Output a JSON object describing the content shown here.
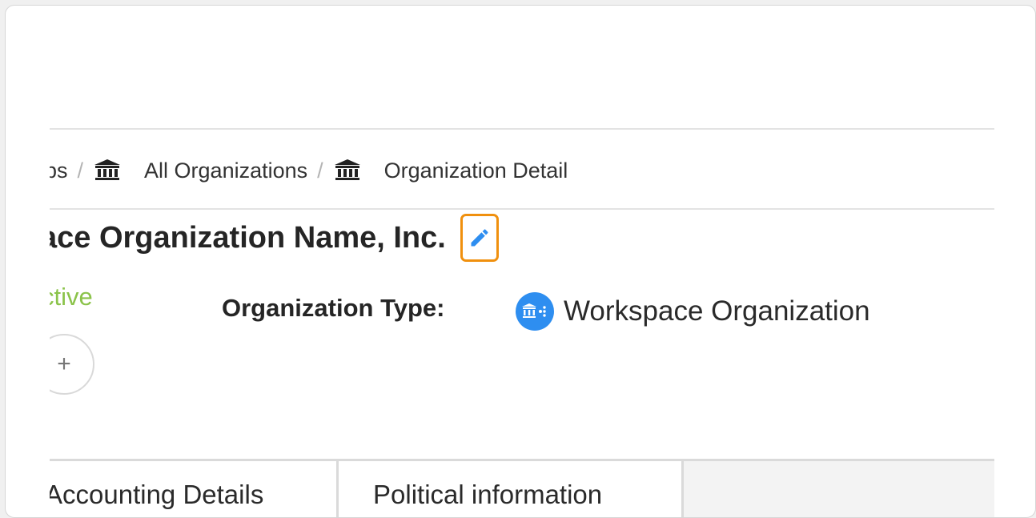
{
  "breadcrumb": {
    "partial_prefix": "ips",
    "separator": "/",
    "items": [
      {
        "label": "All Organizations",
        "icon": "bank-icon"
      },
      {
        "label": "Organization Detail",
        "icon": "bank-icon"
      }
    ]
  },
  "organization": {
    "name": "ace Organization Name, Inc.",
    "status": "ctive",
    "add_label": "+",
    "type_label": "Organization Type:",
    "type_value": "Workspace Organization",
    "type_icon": "workspace-organization-icon"
  },
  "tabs": [
    {
      "label": "Accounting Details"
    },
    {
      "label": "Political information"
    }
  ],
  "colors": {
    "status_active": "#8bc34a",
    "edit_highlight": "#f0900e",
    "edit_icon": "#2e8ef0",
    "org_badge": "#2e8ef0"
  }
}
